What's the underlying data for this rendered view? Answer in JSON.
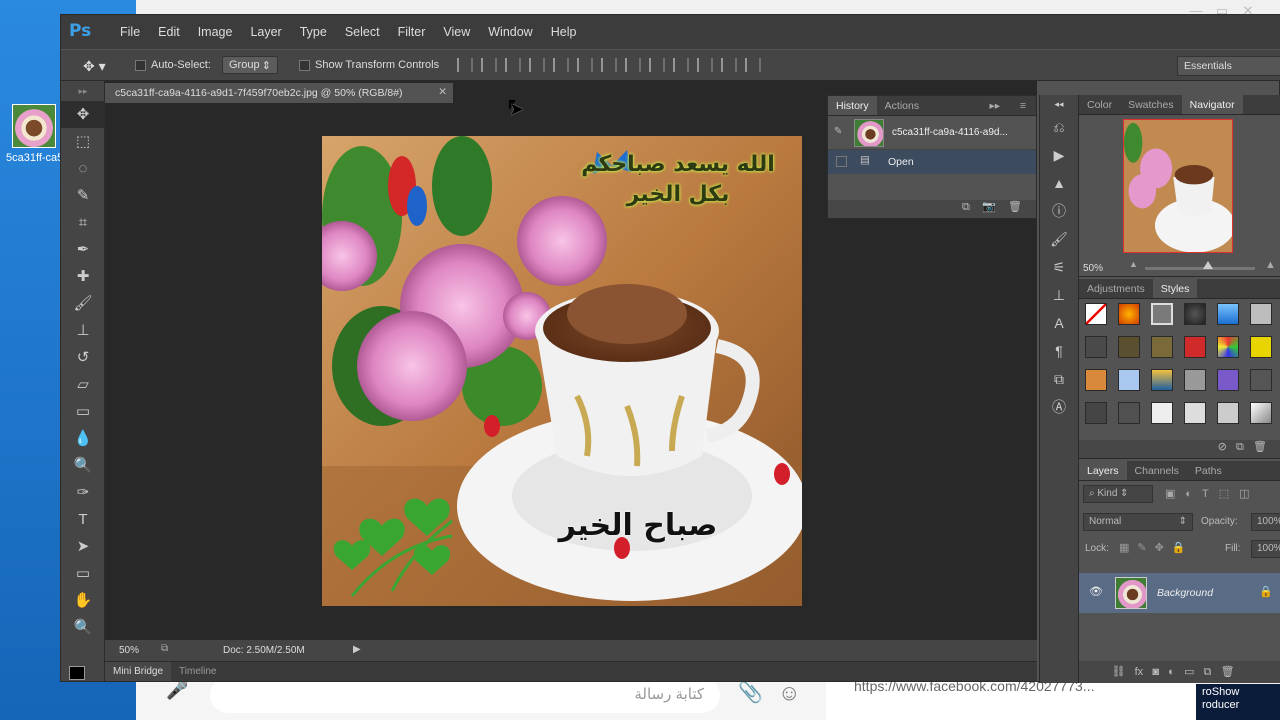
{
  "desktop": {
    "icon_label": "5ca31ff-ca5"
  },
  "chat": {
    "placeholder": "كتابة رسالة",
    "fb_link": "https://www.facebook.com/42027773...",
    "proshow": "roShow roducer"
  },
  "app": {
    "logo": "Ps",
    "menu": [
      "File",
      "Edit",
      "Image",
      "Layer",
      "Type",
      "Select",
      "Filter",
      "View",
      "Window",
      "Help"
    ],
    "workspace": "Essentials"
  },
  "options": {
    "auto_select": "Auto-Select:",
    "group": "Group",
    "transform": "Show Transform Controls"
  },
  "document": {
    "tab_title": "c5ca31ff-ca9a-4116-a9d1-7f459f70eb2c.jpg @ 50% (RGB/8#)",
    "zoom": "50%",
    "doc_size": "Doc: 2.50M/2.50M",
    "image_text_top": "الله يسعد صباحكم بكل الخير",
    "image_text_bottom": "صباح الخير"
  },
  "bottom_tabs": [
    "Mini Bridge",
    "Timeline"
  ],
  "history": {
    "tabs": [
      "History",
      "Actions"
    ],
    "snapshot": "c5ca31ff-ca9a-4116-a9d...",
    "open": "Open"
  },
  "navigator": {
    "tabs": [
      "Color",
      "Swatches",
      "Navigator"
    ],
    "zoom": "50%"
  },
  "adjust": {
    "tabs": [
      "Adjustments",
      "Styles"
    ]
  },
  "layers": {
    "tabs": [
      "Layers",
      "Channels",
      "Paths"
    ],
    "kind": "Kind",
    "blend": "Normal",
    "opacity_label": "Opacity:",
    "opacity_value": "100%",
    "lock_label": "Lock:",
    "fill_label": "Fill:",
    "fill_value": "100%",
    "background": "Background"
  },
  "colors": {
    "ps_blue": "#3d9fe6",
    "selection": "#5a6b85"
  }
}
